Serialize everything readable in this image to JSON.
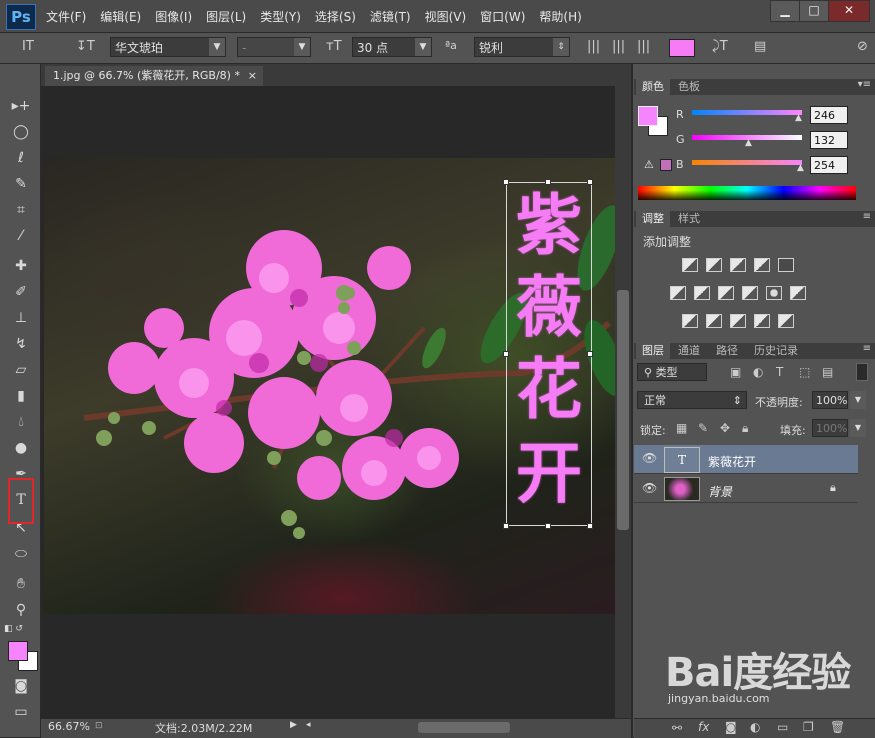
{
  "app": {
    "logo": "Ps"
  },
  "menu": [
    "文件(F)",
    "编辑(E)",
    "图像(I)",
    "图层(L)",
    "类型(Y)",
    "选择(S)",
    "滤镜(T)",
    "视图(V)",
    "窗口(W)",
    "帮助(H)"
  ],
  "window_controls": {
    "minimize": "▁",
    "maximize": "□",
    "close": "✕"
  },
  "options": {
    "font_family": "华文琥珀",
    "font_style": "-",
    "font_size": "30 点",
    "antialias": "锐利",
    "text_color": "#f57cf4"
  },
  "document": {
    "tab_title": "1.jpg @ 66.7% (紫薇花开, RGB/8) *",
    "tab_close": "×",
    "vertical_text": [
      "紫",
      "薇",
      "花",
      "开"
    ],
    "text_color": "#f57cf4"
  },
  "status": {
    "zoom": "66.67%",
    "doc_info": "文档:2.03M/2.22M"
  },
  "color_panel": {
    "tabs": [
      "颜色",
      "色板"
    ],
    "channels": [
      {
        "label": "R",
        "value": "246"
      },
      {
        "label": "G",
        "value": "132"
      },
      {
        "label": "B",
        "value": "254"
      }
    ],
    "foreground": "#f684fe",
    "background": "#ffffff"
  },
  "adjust_panel": {
    "tabs": [
      "调整",
      "样式"
    ],
    "title": "添加调整"
  },
  "layers_panel": {
    "tabs": [
      "图层",
      "通道",
      "路径",
      "历史记录"
    ],
    "kind_filter": "类型",
    "blend_mode": "正常",
    "opacity_label": "不透明度:",
    "opacity_value": "100%",
    "lock_label": "锁定:",
    "fill_label": "填充:",
    "fill_value": "100%",
    "layers": [
      {
        "name": "紫薇花开",
        "type_glyph": "T",
        "selected": true
      },
      {
        "name": "背景",
        "locked": true
      }
    ]
  },
  "watermark": {
    "brand": "Bai度经验",
    "url": "jingyan.baidu.com"
  }
}
